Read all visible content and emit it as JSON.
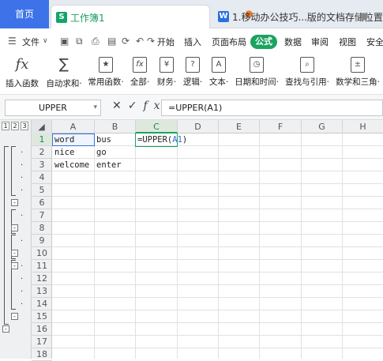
{
  "tabs": {
    "home": "首页",
    "sheet": "工作簿1",
    "sheet_badge": "S",
    "doc": "1.移动办公技巧...版的文档存储位置",
    "doc_badge": "W"
  },
  "menu": {
    "file": "文件",
    "items": [
      "开始",
      "插入",
      "页面布局",
      "公式",
      "数据",
      "审阅",
      "视图",
      "安全"
    ],
    "active": "公式"
  },
  "ribbon": [
    {
      "label": "插入函数",
      "icon": "fx-icon"
    },
    {
      "label": "自动求和·",
      "icon": "sum-icon"
    },
    {
      "label": "常用函数·",
      "icon": "common-function-icon"
    },
    {
      "label": "全部·",
      "icon": "all-functions-icon"
    },
    {
      "label": "财务·",
      "icon": "finance-icon"
    },
    {
      "label": "逻辑·",
      "icon": "logic-icon"
    },
    {
      "label": "文本·",
      "icon": "text-icon"
    },
    {
      "label": "日期和时间·",
      "icon": "datetime-icon"
    },
    {
      "label": "查找与引用·",
      "icon": "lookup-icon"
    },
    {
      "label": "数学和三角·",
      "icon": "math-icon"
    }
  ],
  "formula_bar": {
    "name_box": "UPPER",
    "formula": "=UPPER(A1)"
  },
  "outline_levels": [
    "1",
    "2",
    "3"
  ],
  "columns": [
    "A",
    "B",
    "C",
    "D",
    "E",
    "F",
    "G",
    "H"
  ],
  "rows": [
    "1",
    "2",
    "3",
    "4",
    "5",
    "6",
    "7",
    "8",
    "9",
    "10",
    "11",
    "12",
    "13",
    "14",
    "15",
    "16",
    "17",
    "18"
  ],
  "cells": {
    "A1": "word",
    "B1": "bus",
    "C1_prefix": "=UPPER(",
    "C1_ref": "A1",
    "C1_suffix": ")",
    "A2": "nice",
    "B2": "go",
    "A3": "welcome",
    "B3": "enter"
  },
  "accent_color": "#1aa361"
}
